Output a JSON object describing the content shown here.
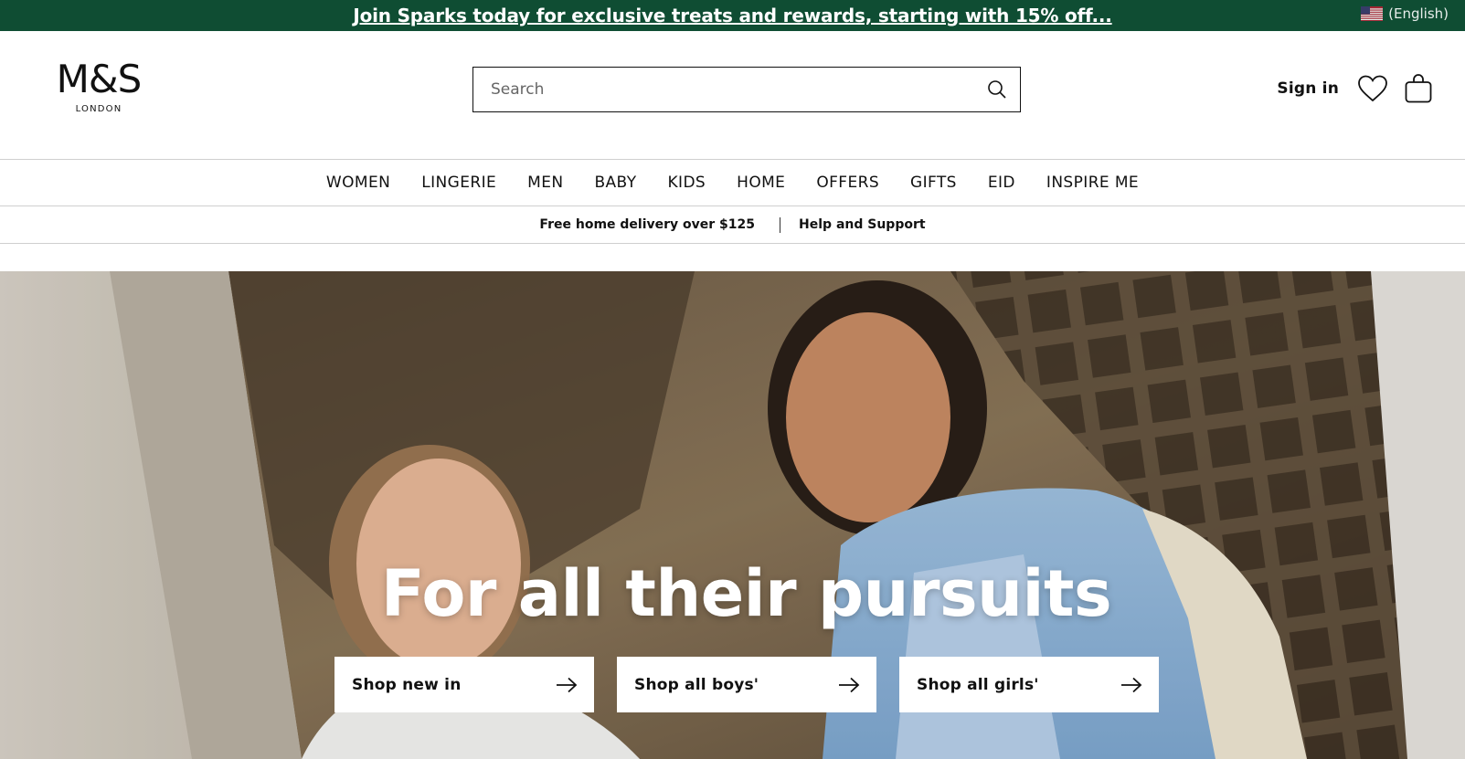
{
  "promo": {
    "text": "Join Sparks today for exclusive treats and rewards, starting with 15% off...",
    "background": "#0f4d33"
  },
  "locale": {
    "label": "(English)",
    "flag_icon": "us-flag-icon"
  },
  "logo": {
    "main": "M&S",
    "sub": "LONDON"
  },
  "search": {
    "placeholder": "Search",
    "value": "",
    "icon": "search-icon"
  },
  "header_actions": {
    "sign_in": "Sign in",
    "wishlist_icon": "heart-icon",
    "bag_icon": "shopping-bag-icon"
  },
  "nav": {
    "items": [
      "WOMEN",
      "LINGERIE",
      "MEN",
      "BABY",
      "KIDS",
      "HOME",
      "OFFERS",
      "GIFTS",
      "EID",
      "INSPIRE ME"
    ]
  },
  "info_bar": {
    "delivery": "Free home delivery over $125",
    "help": "Help and Support"
  },
  "hero": {
    "title": "For all their pursuits",
    "ctas": [
      {
        "label": "Shop new in",
        "icon": "arrow-right-icon"
      },
      {
        "label": "Shop all boys'",
        "icon": "arrow-right-icon"
      },
      {
        "label": "Shop all girls'",
        "icon": "arrow-right-icon"
      }
    ]
  }
}
